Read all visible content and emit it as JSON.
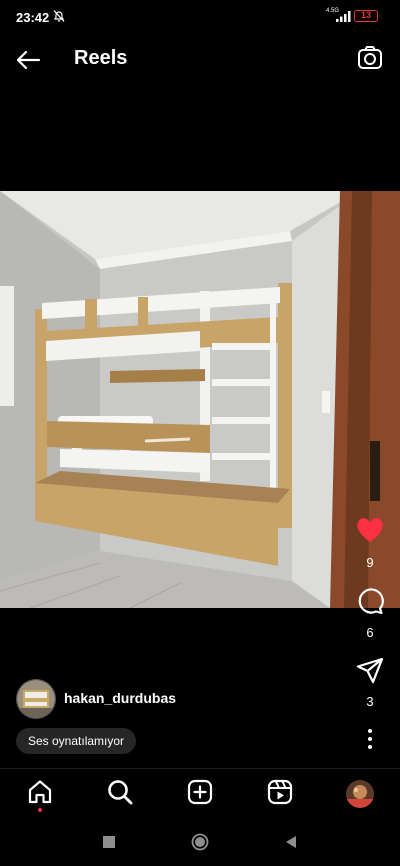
{
  "status_bar": {
    "time": "23:42",
    "network": "4.5G",
    "battery": "13"
  },
  "header": {
    "title": "Reels"
  },
  "actions": {
    "likes": "9",
    "comments": "6",
    "shares": "3"
  },
  "author": {
    "username": "hakan_durdubas"
  },
  "audio": {
    "label": "Ses oynatılamıyor"
  },
  "colors": {
    "like": "#ff3040",
    "battery": "#e53935",
    "background": "#000000"
  }
}
